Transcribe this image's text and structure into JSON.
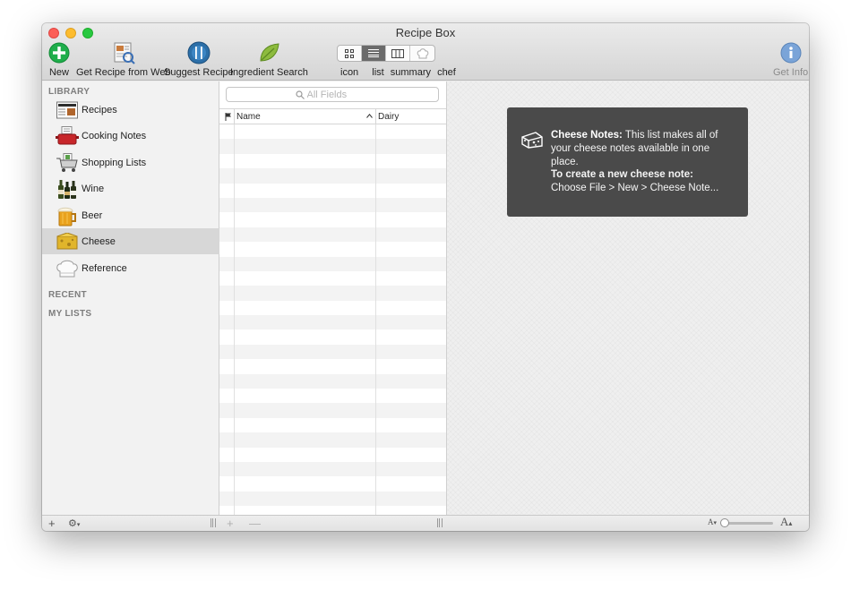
{
  "window": {
    "title": "Recipe Box"
  },
  "toolbar": {
    "new_label": "New",
    "get_web_label": "Get Recipe from Web",
    "suggest_label": "Suggest Recipe",
    "ingredient_label": "Ingredient Search",
    "get_info_label": "Get Info",
    "view_modes": [
      "icon",
      "list",
      "summary",
      "chef"
    ],
    "active_view": "list"
  },
  "sidebar": {
    "library_header": "LIBRARY",
    "recent_header": "RECENT",
    "my_lists_header": "MY LISTS",
    "items": [
      {
        "label": "Recipes",
        "icon": "recipe-card-icon"
      },
      {
        "label": "Cooking Notes",
        "icon": "pot-icon"
      },
      {
        "label": "Shopping Lists",
        "icon": "shopping-cart-icon"
      },
      {
        "label": "Wine",
        "icon": "wine-bottles-icon"
      },
      {
        "label": "Beer",
        "icon": "beer-mug-icon"
      },
      {
        "label": "Cheese",
        "icon": "cheese-icon"
      },
      {
        "label": "Reference",
        "icon": "chef-hat-icon"
      }
    ],
    "selected": "Cheese"
  },
  "list": {
    "search_placeholder": "All Fields",
    "columns": [
      "Name",
      "Dairy"
    ],
    "sorted_column": "Name",
    "row_count": 0
  },
  "info": {
    "title": "Cheese Notes:",
    "body": " This list makes all of your cheese notes available in one place.",
    "create_title": "To create a new cheese note:",
    "create_body": "Choose File > New > Cheese Note..."
  },
  "colors": {
    "info_bg": "#4a4a4a",
    "selection": "#d7d7d7",
    "new_button": "#1fae4b",
    "info_button": "#5b8fd6"
  }
}
